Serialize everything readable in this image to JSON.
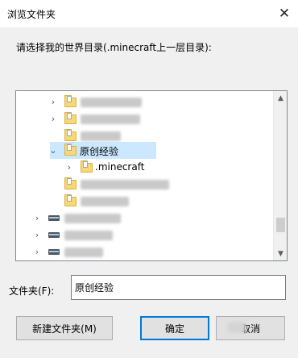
{
  "window": {
    "title": "浏览文件夹",
    "close_glyph": "✕"
  },
  "prompt": "请选择我的世界目录(.minecraft上一层目录):",
  "tree": {
    "items": [
      {
        "label": "",
        "expander": "›",
        "icon": "folder-icon",
        "obscured": true
      },
      {
        "label": "",
        "expander": "›",
        "icon": "folder-icon",
        "obscured": true
      },
      {
        "label": "",
        "expander": "",
        "icon": "folder-icon",
        "obscured": true
      },
      {
        "label": "原创经验",
        "expander": "⌄",
        "icon": "folder-icon",
        "selected": true
      },
      {
        "label": ".minecraft",
        "expander": "›",
        "icon": "folder-icon"
      },
      {
        "label": "",
        "expander": "",
        "icon": "folder-icon",
        "obscured": true
      },
      {
        "label": "",
        "expander": "",
        "icon": "folder-icon",
        "obscured": true
      },
      {
        "label": "",
        "expander": "›",
        "icon": "drive-icon",
        "obscured": true
      },
      {
        "label": "",
        "expander": "›",
        "icon": "drive-icon",
        "obscured": true
      },
      {
        "label": "",
        "expander": "›",
        "icon": "drive-icon",
        "obscured": true
      }
    ],
    "scroll": {
      "up_glyph": "▲",
      "down_glyph": "▼"
    }
  },
  "folder_field": {
    "label": "文件夹(F):",
    "value": "原创经验"
  },
  "buttons": {
    "new_folder": "新建文件夹(M)",
    "ok": "确定",
    "cancel": "取消"
  },
  "colors": {
    "selection": "#cce8ff",
    "primary_border": "#0078d7"
  }
}
